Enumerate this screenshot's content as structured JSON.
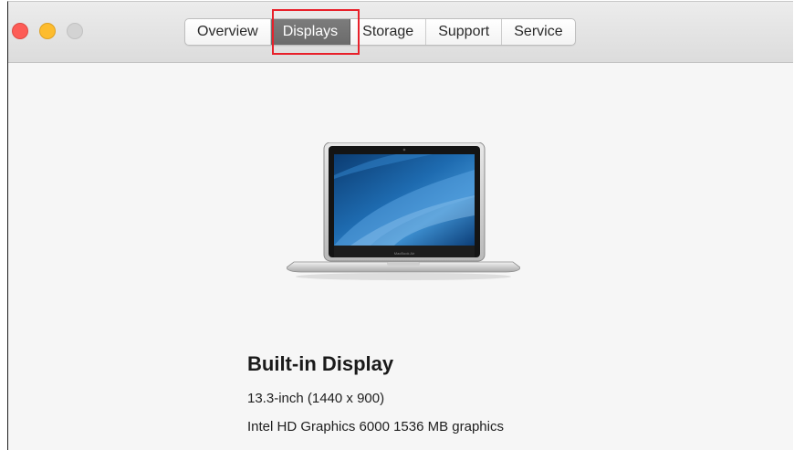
{
  "window": {
    "traffic_lights": {
      "close_color": "#fd5c56",
      "minimize_color": "#fdbc2e",
      "zoom_color": "#d3d3d3"
    }
  },
  "tabs": [
    {
      "label": "Overview",
      "active": false
    },
    {
      "label": "Displays",
      "active": true
    },
    {
      "label": "Storage",
      "active": false
    },
    {
      "label": "Support",
      "active": false
    },
    {
      "label": "Service",
      "active": false
    }
  ],
  "highlight": {
    "target": "Displays",
    "color": "#e8202a"
  },
  "display": {
    "image_icon": "macbook-air-icon",
    "name": "Built-in Display",
    "size": "13.3-inch (1440 x 900)",
    "graphics": "Intel HD Graphics 6000 1536 MB graphics"
  }
}
